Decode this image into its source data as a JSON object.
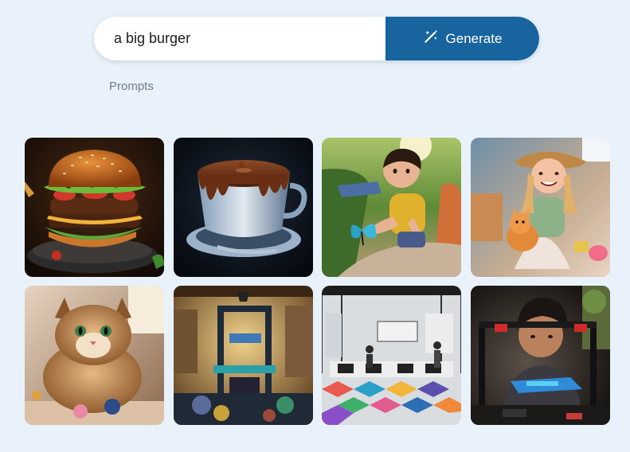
{
  "search": {
    "value": "a big burger",
    "button_label": "Generate",
    "button_icon": "magic-wand-icon",
    "accent_color": "#17649e"
  },
  "prompts_label": "Prompts",
  "gallery": {
    "items": [
      {
        "subject": "burger",
        "icon": "burger-image"
      },
      {
        "subject": "chocolate cup",
        "icon": "chocolate-cup-image"
      },
      {
        "subject": "boy with butterfly",
        "icon": "boy-butterfly-image"
      },
      {
        "subject": "girl with kitten",
        "icon": "girl-kitten-image"
      },
      {
        "subject": "fluffy cat",
        "icon": "cat-image"
      },
      {
        "subject": "3d printer",
        "icon": "3d-printer-image"
      },
      {
        "subject": "office",
        "icon": "office-image"
      },
      {
        "subject": "boy with 3d printer",
        "icon": "boy-printer-image"
      }
    ]
  }
}
